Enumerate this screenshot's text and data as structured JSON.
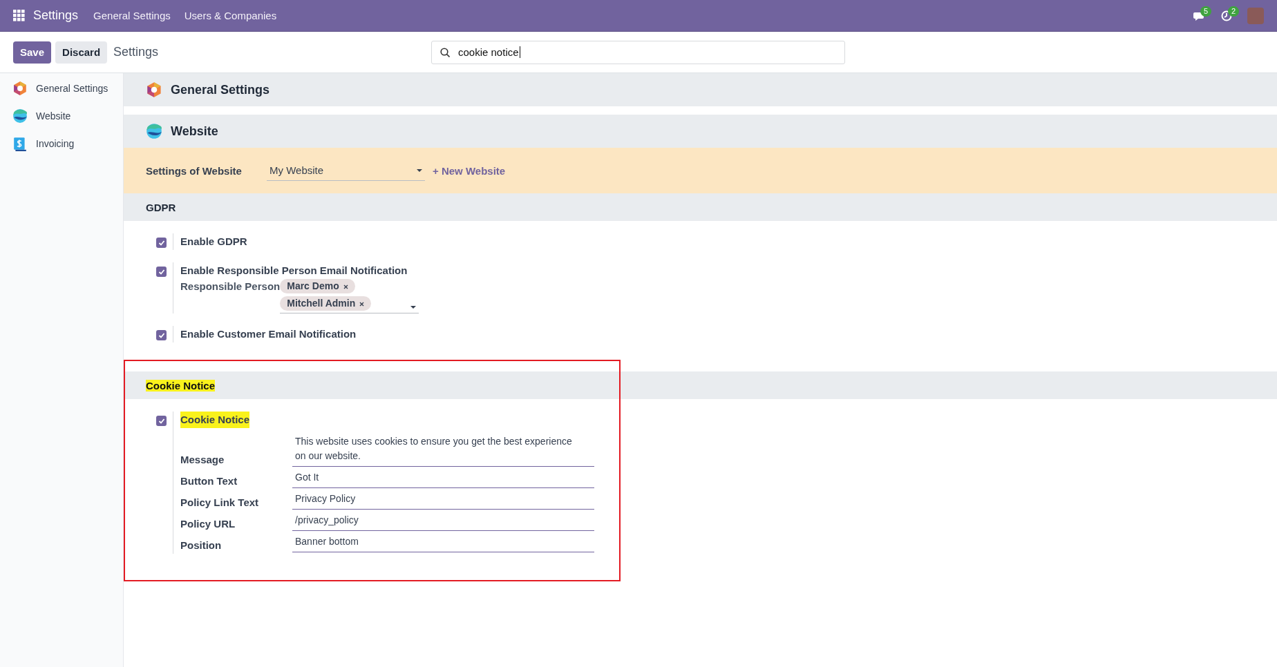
{
  "app_bar": {
    "app_name": "Settings",
    "menu": [
      "General Settings",
      "Users & Companies"
    ],
    "messages_badge": "5",
    "activities_badge": "2"
  },
  "control_panel": {
    "buttons": [
      "Save",
      "Discard"
    ],
    "breadcrumb": "Settings",
    "search": {
      "value": "cookie notice"
    }
  },
  "sidebar": {
    "items": [
      {
        "label": "General Settings",
        "kind": "general",
        "selected": false
      },
      {
        "label": "Website",
        "kind": "website",
        "selected": false
      },
      {
        "label": "Invoicing",
        "kind": "invoicing",
        "selected": false
      }
    ]
  },
  "general_settings": {
    "title": "General Settings",
    "kind": "general"
  },
  "website": {
    "title": "Website",
    "kind": "website",
    "selector": {
      "label": "Settings of Website",
      "value": "My Website",
      "link": "+ New Website"
    },
    "groups": [
      {
        "title": "GDPR",
        "highlighted": false,
        "framed": false,
        "settings": [
          {
            "label": "Enable GDPR",
            "checked": true,
            "highlighted": false
          },
          {
            "label": "Enable Responsible Person Email Notification",
            "checked": true,
            "highlighted": false,
            "tag_field": {
              "label": "Responsible Person",
              "tags": [
                "Marc Demo",
                "Mitchell Admin"
              ]
            }
          },
          {
            "label": "Enable Customer Email Notification",
            "checked": true,
            "highlighted": false
          }
        ]
      },
      {
        "title": "Cookie Notice",
        "highlighted": true,
        "framed": true,
        "settings": [
          {
            "label": "Cookie Notice",
            "checked": true,
            "highlighted": true,
            "fields": [
              {
                "label": "Message",
                "value": "This website uses cookies to ensure you get the best experience on our website."
              },
              {
                "label": "Button Text",
                "value": "Got It"
              },
              {
                "label": "Policy Link Text",
                "value": "Privacy Policy"
              },
              {
                "label": "Policy URL",
                "value": "/privacy_policy"
              },
              {
                "label": "Position",
                "value": "Banner bottom"
              }
            ]
          }
        ]
      }
    ]
  }
}
